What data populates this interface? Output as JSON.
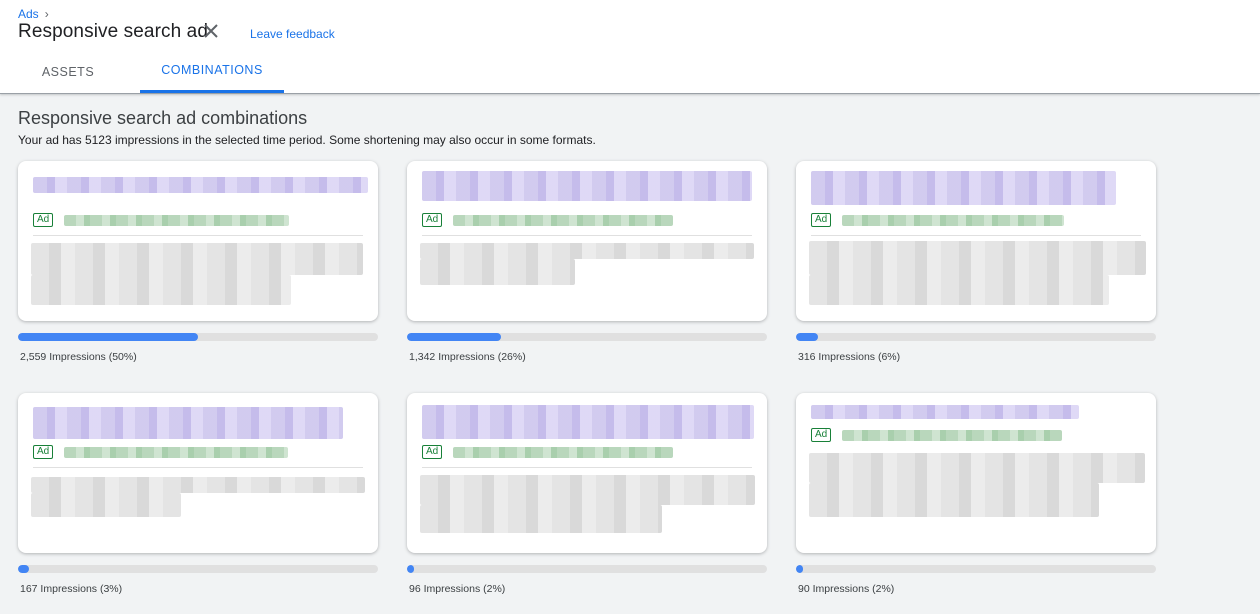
{
  "header": {
    "breadcrumb": "Ads",
    "title": "Responsive search ad",
    "feedback": "Leave feedback",
    "tabs": [
      {
        "label": "ASSETS",
        "active": false
      },
      {
        "label": "COMBINATIONS",
        "active": true
      }
    ]
  },
  "main": {
    "title": "Responsive search ad combinations",
    "subtitle": "Your ad has 5123 impressions in the selected time period. Some shortening may also occur in some formats.",
    "ad_badge": "Ad",
    "combinations": [
      {
        "impressions": "2,559 Impressions (50%)",
        "share": 0.5
      },
      {
        "impressions": "1,342 Impressions (26%)",
        "share": 0.26
      },
      {
        "impressions": "316 Impressions (6%)",
        "share": 0.06
      },
      {
        "impressions": "167 Impressions (3%)",
        "share": 0.03
      },
      {
        "impressions": "96 Impressions (2%)",
        "share": 0.02
      },
      {
        "impressions": "90 Impressions (2%)",
        "share": 0.02
      }
    ]
  },
  "colors": {
    "accent": "#1a73e8",
    "bar_fill": "#4285f4",
    "ad_green": "#188038"
  },
  "icons": {
    "close": "close-icon",
    "breadcrumb_separator": "chevron-right-icon"
  }
}
